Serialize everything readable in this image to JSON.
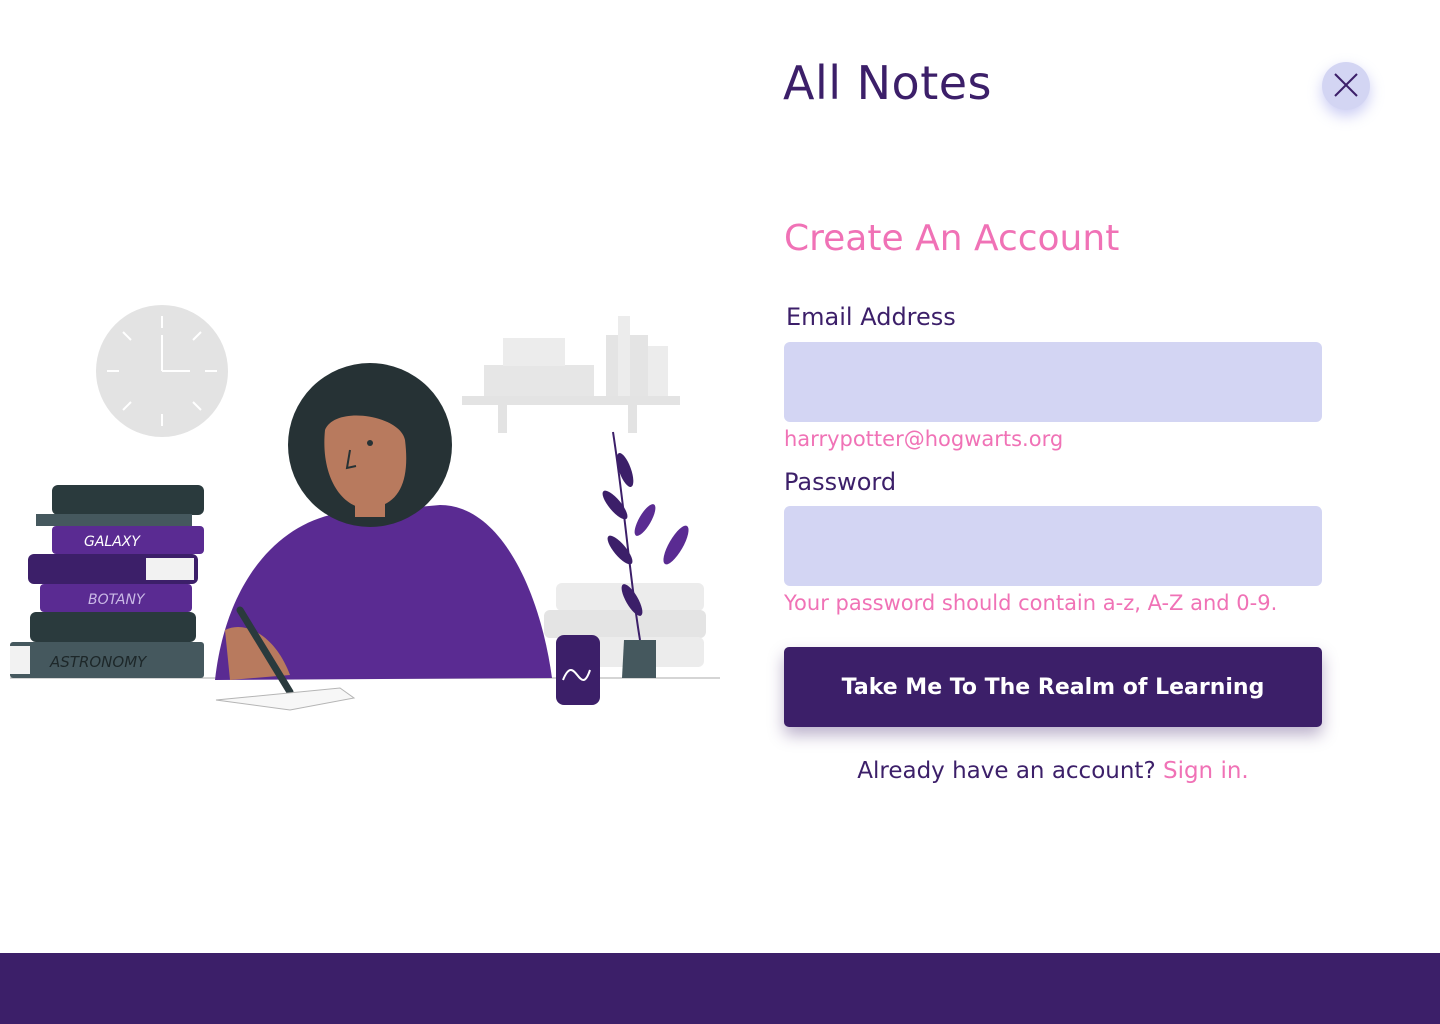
{
  "app": {
    "title": "All Notes"
  },
  "colors": {
    "primary": "#3c1f69",
    "accent_pink": "#f072b6",
    "input_bg": "#d3d5f3",
    "book_purple": "#5a2b92",
    "book_dark": "#2a3a3d",
    "book_slate": "#45585e"
  },
  "icons": {
    "close": "close-icon"
  },
  "form": {
    "heading": "Create An Account",
    "email": {
      "label": "Email Address",
      "value": "",
      "placeholder": "",
      "helper": "harrypotter@hogwarts.org"
    },
    "password": {
      "label": "Password",
      "value": "",
      "placeholder": "",
      "helper": "Your password should contain a-z, A-Z and 0-9."
    },
    "submit_label": "Take Me To The Realm of Learning",
    "signin_prompt": "Already have an account?",
    "signin_link": "Sign in."
  },
  "illustration": {
    "books": [
      "GALAXY",
      "BOTANY",
      "ASTRONOMY"
    ]
  }
}
